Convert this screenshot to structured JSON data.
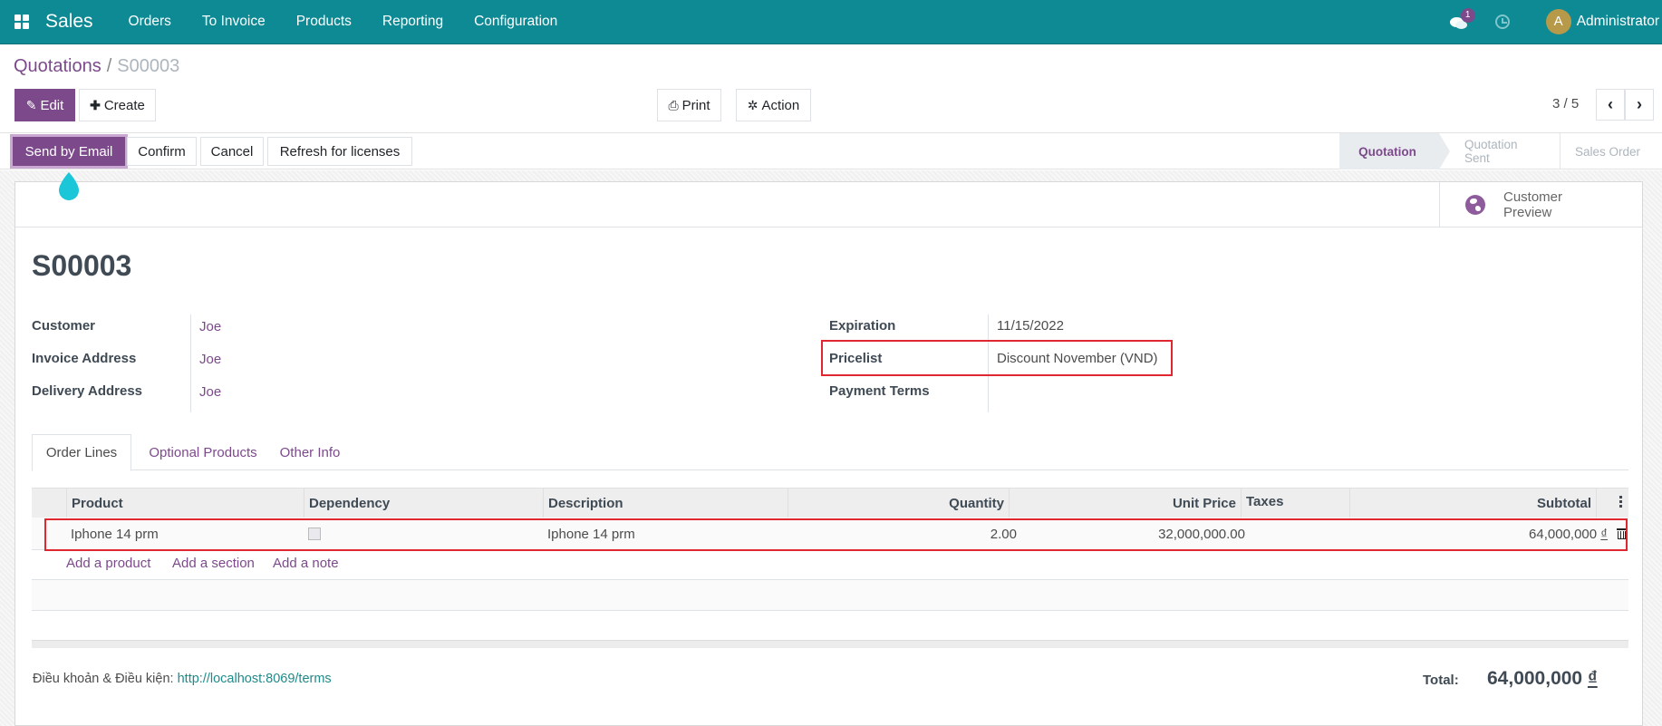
{
  "navbar": {
    "app_name": "Sales",
    "menu": [
      "Orders",
      "To Invoice",
      "Products",
      "Reporting",
      "Configuration"
    ],
    "messages_count": "1",
    "user_initial": "A",
    "user_name": "Administrator"
  },
  "breadcrumb": {
    "parent": "Quotations",
    "separator": "/",
    "current": "S00003"
  },
  "toolbar": {
    "edit_label": "Edit",
    "create_label": "Create",
    "print_label": "Print",
    "action_label": "Action",
    "pager_value": "3 / 5"
  },
  "header_buttons": {
    "send_email": "Send by Email",
    "confirm": "Confirm",
    "cancel": "Cancel",
    "refresh_licenses": "Refresh for licenses"
  },
  "status_stages": [
    {
      "label": "Quotation",
      "active": true
    },
    {
      "label": "Quotation Sent",
      "active": false
    },
    {
      "label": "Sales Order",
      "active": false
    }
  ],
  "smart_button": {
    "line1": "Customer",
    "line2": "Preview"
  },
  "record": {
    "name": "S00003",
    "left_fields": [
      {
        "label": "Customer",
        "value": "Joe"
      },
      {
        "label": "Invoice Address",
        "value": "Joe"
      },
      {
        "label": "Delivery Address",
        "value": "Joe"
      }
    ],
    "right_fields": [
      {
        "label": "Expiration",
        "value": "11/15/2022"
      },
      {
        "label": "Pricelist",
        "value": "Discount November (VND)"
      },
      {
        "label": "Payment Terms",
        "value": ""
      }
    ]
  },
  "tabs": [
    {
      "label": "Order Lines",
      "active": true
    },
    {
      "label": "Optional Products",
      "active": false
    },
    {
      "label": "Other Info",
      "active": false
    }
  ],
  "order_lines": {
    "columns": [
      "Product",
      "Dependency",
      "Description",
      "Quantity",
      "Unit Price",
      "Taxes",
      "Subtotal"
    ],
    "rows": [
      {
        "product": "Iphone 14 prm",
        "dependency": false,
        "description": "Iphone 14 prm",
        "quantity": "2.00",
        "unit_price": "32,000,000.00",
        "taxes": "",
        "subtotal": "64,000,000",
        "currency": "₫"
      }
    ],
    "add_links": [
      "Add a product",
      "Add a section",
      "Add a note"
    ]
  },
  "footer": {
    "terms_label": "Điều khoản & Điều kiện:",
    "terms_url": "http://localhost:8069/terms",
    "total_label": "Total:",
    "total_value": "64,000,000",
    "total_currency": "₫"
  },
  "colors": {
    "navbar": "#0e8a95",
    "primary": "#7c4a8b",
    "highlight_box": "#e0262e",
    "pin": "#1cc6d9"
  }
}
